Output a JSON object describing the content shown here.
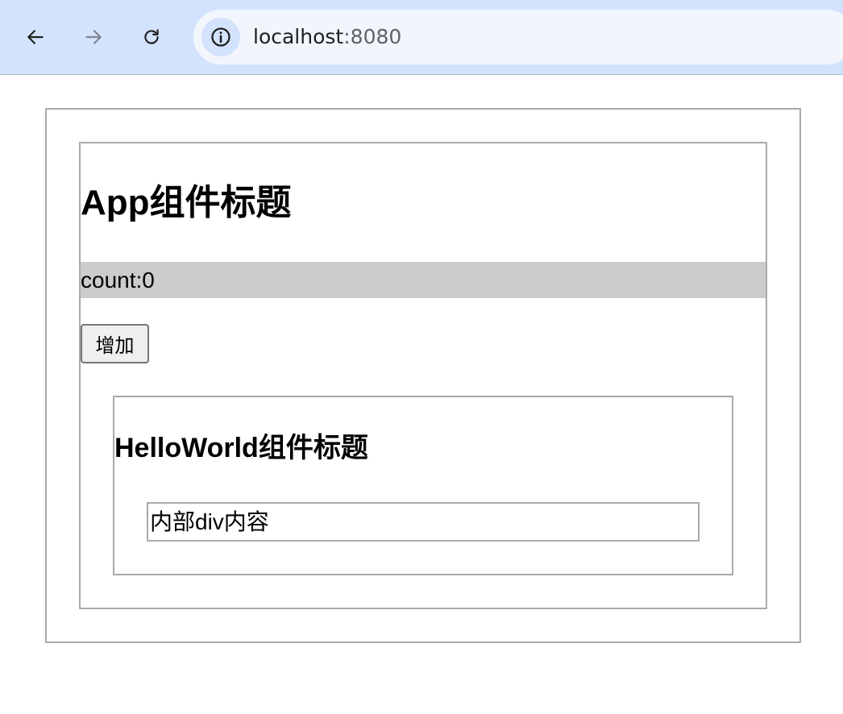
{
  "browser": {
    "url_host": "localhost",
    "url_port": ":8080",
    "icons": {
      "back": "arrow-left-icon",
      "forward": "arrow-right-icon",
      "reload": "reload-icon",
      "site_info": "info-icon"
    }
  },
  "app": {
    "title": "App组件标题",
    "count_text": "count:0",
    "increase_button_label": "增加",
    "hello_world": {
      "title": "HelloWorld组件标题",
      "inner_div_text": "内部div内容"
    }
  },
  "colors": {
    "toolbar_bg": "#d3e3fd",
    "omnibox_bg": "#f2f6fc",
    "count_bar_bg": "#cccccc",
    "border": "#aaaaaa"
  }
}
